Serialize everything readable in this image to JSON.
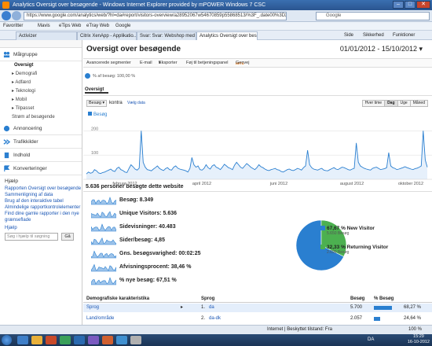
{
  "browser": {
    "title": "Analytics Oversigt over besøgende - Windows Internet Explorer provided by mPOWER Windows 7 CSC",
    "url": "https://www.google.com/analytics/web/?hl=da#report/visitors-overview/a28952067w54670859p55868513/%3F_.date00%3D20120101%26_.date01%3D",
    "search_text": "Google",
    "favorites": [
      "Favoritter",
      "Mavis",
      "eTips Web",
      "eTray Web",
      "Google"
    ],
    "tabs": [
      "Activizer",
      "Citrix XenApp - Applikatio...",
      "Svar: Svar: Webshop med s...",
      "Analytics Oversigt over besøgen..."
    ],
    "tools": [
      "Side",
      "Sikkerhed",
      "Funktioner"
    ]
  },
  "sidebar": {
    "sections": [
      {
        "label": "Målgruppe",
        "icon": "people-icon"
      },
      {
        "label": "Annoncering",
        "icon": "megaphone-icon"
      },
      {
        "label": "Trafikkilder",
        "icon": "arrows-icon"
      },
      {
        "label": "Indhold",
        "icon": "document-icon"
      },
      {
        "label": "Konverteringer",
        "icon": "flag-icon"
      }
    ],
    "audience_items": [
      "Oversigt",
      "Demografi",
      "Adfærd",
      "Teknologi",
      "Mobil",
      "Tilpasset",
      "Strøm af besøgende"
    ],
    "help_title": "Hjælp",
    "help_links": [
      "Rapporten Oversigt over besøgende",
      "Sammenligning af data",
      "Brug af den interaktive tabel",
      "Almindelige rapportkontrolelementer",
      "Find dine gamle rapporter i den nye grænseflade"
    ],
    "help_search_label": "Hjælp",
    "help_search_placeholder": "Søg i hjælp til søgning",
    "go_label": "Gå"
  },
  "report": {
    "title": "Oversigt over besøgende",
    "date_range": "01/01/2012 - 15/10/2012",
    "actions": [
      "Avancerede segmenter",
      "E-mail",
      "Eksporter",
      "Føj til betjeningspanel",
      "Genvej"
    ],
    "beta": "BETA",
    "segment": "% af besøg: 100,00 %",
    "tab": "Oversigt",
    "metric_select": "Besøg",
    "compare": "kontra",
    "choose_metric": "Vælg data",
    "granularity": [
      "Hver time",
      "Dag",
      "Uge",
      "Måned"
    ],
    "series_label": "Besøg",
    "summary_title": "5.636 personer besøgte dette website",
    "metrics": [
      {
        "label": "Besøg:",
        "value": "8.349"
      },
      {
        "label": "Unique Visitors:",
        "value": "5.636"
      },
      {
        "label": "Sidevisninger:",
        "value": "40.483"
      },
      {
        "label": "Sider/besøg:",
        "value": "4,85"
      },
      {
        "label": "Gns. besøgsvarighed:",
        "value": "00:02:25"
      },
      {
        "label": "Afvisningsprocent:",
        "value": "38,46 %"
      },
      {
        "label": "% nye besøg:",
        "value": "67,51 %"
      }
    ],
    "pie": [
      {
        "label": "New Visitor",
        "percent": "67,67 %",
        "visits": "5.650 Besøg",
        "color": "#2a7fd0",
        "value": 67.67
      },
      {
        "label": "Returning Visitor",
        "percent": "32,33 %",
        "visits": "2.699 Besøg",
        "color": "#4cb050",
        "value": 32.33
      }
    ],
    "demo_header": [
      "Demografiske karakteristika",
      "Sprog",
      "Besøg",
      "% Besøg"
    ],
    "demo_rows": [
      {
        "cat": "Sprog",
        "num": "1.",
        "lang": "da",
        "visits": "5.700",
        "pct": "68,27 %",
        "share": 68.27
      },
      {
        "cat": "Land/område",
        "num": "2.",
        "lang": "da-dk",
        "visits": "2.057",
        "pct": "24,64 %",
        "share": 24.64
      }
    ]
  },
  "status": {
    "zone": "Internet | Beskyttet tilstand: Fra",
    "zoom": "100 %"
  },
  "taskbar": {
    "lang": "DA",
    "time": "15:29",
    "date": "16-10-2012"
  },
  "chart_data": {
    "type": "line",
    "series": [
      {
        "name": "Besøg",
        "values": [
          22,
          30,
          25,
          28,
          40,
          35,
          26,
          24,
          28,
          30,
          34,
          38,
          42,
          35,
          32,
          45,
          50,
          40,
          36,
          30,
          28,
          45,
          60,
          52,
          42,
          38,
          46,
          200,
          70,
          50,
          40,
          38,
          35,
          42,
          48,
          55,
          45,
          40,
          36,
          44,
          48,
          40,
          38,
          50,
          55,
          46,
          42,
          40,
          38,
          35,
          30,
          45,
          90,
          60,
          50,
          55,
          40,
          38,
          45,
          60,
          48,
          42,
          55,
          60,
          50,
          46,
          40,
          50,
          62,
          55,
          48,
          45,
          40,
          58,
          70,
          60,
          50,
          45,
          55,
          65,
          58,
          50,
          45,
          40,
          48,
          60,
          52,
          48,
          42,
          38,
          36,
          40,
          42,
          45,
          40,
          38,
          32,
          30,
          35,
          40,
          42,
          38,
          36,
          40,
          45,
          42,
          38,
          48,
          55,
          120,
          60,
          48,
          42,
          40,
          38,
          42,
          45,
          38,
          36,
          35,
          40,
          44,
          48,
          42,
          40,
          45,
          50,
          48,
          44,
          40,
          38,
          42,
          45,
          150,
          70,
          55,
          50,
          45,
          42,
          40,
          38,
          45,
          48,
          50,
          45,
          40,
          42,
          44,
          48,
          110,
          55,
          48,
          45,
          40,
          42,
          45,
          48,
          52,
          48,
          45,
          42,
          40,
          44,
          46,
          50,
          55,
          200,
          80,
          50
        ]
      }
    ],
    "x_tick_labels": [
      "februar 2012",
      "april 2012",
      "juni 2012",
      "august 2012",
      "oktober 2012"
    ],
    "y_tick_labels": [
      "200",
      "100"
    ],
    "ylim": [
      0,
      240
    ],
    "grid": true
  }
}
